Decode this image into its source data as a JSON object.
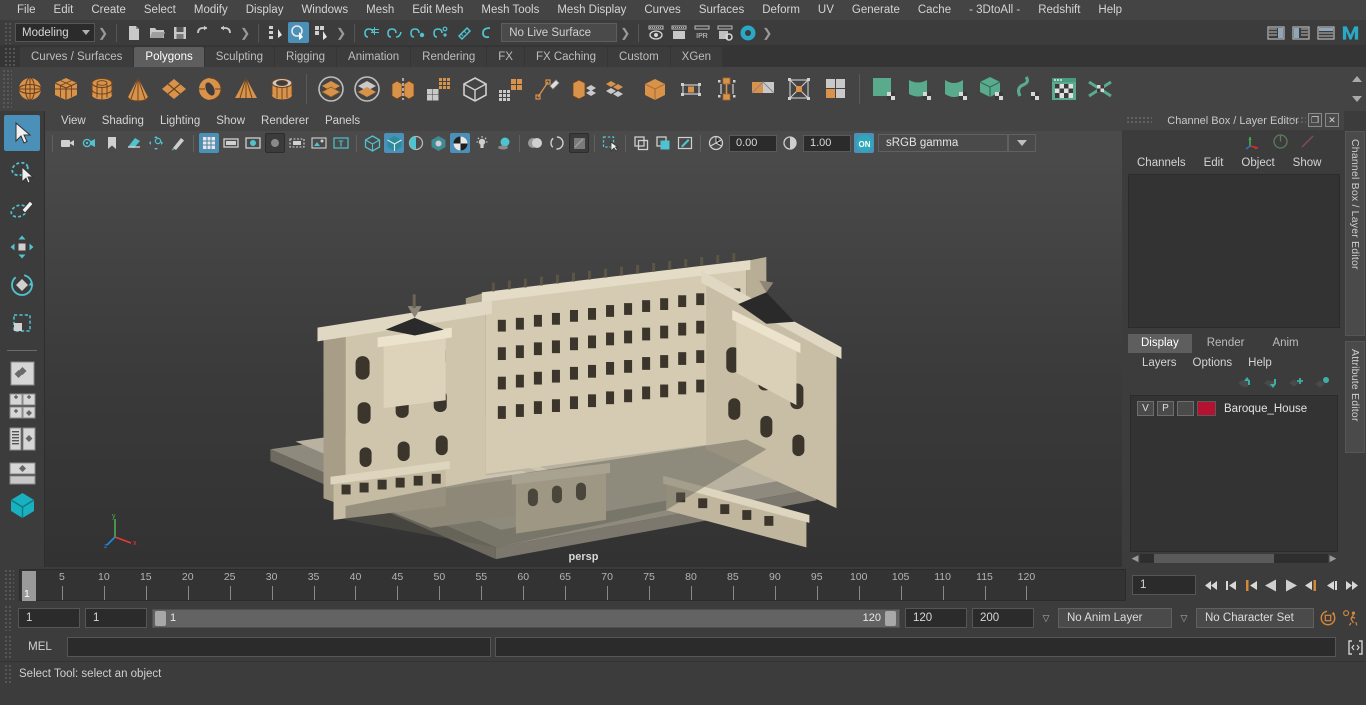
{
  "menubar": {
    "items": [
      "File",
      "Edit",
      "Create",
      "Select",
      "Modify",
      "Display",
      "Windows",
      "Mesh",
      "Edit Mesh",
      "Mesh Tools",
      "Mesh Display",
      "Curves",
      "Surfaces",
      "Deform",
      "UV",
      "Generate",
      "Cache",
      "- 3DtoAll -",
      "Redshift",
      "Help"
    ]
  },
  "statusline": {
    "menuset": "Modeling",
    "live_surface": "No Live Surface",
    "icons": [
      {
        "name": "new-scene-icon"
      },
      {
        "name": "open-scene-icon"
      },
      {
        "name": "save-scene-icon"
      },
      {
        "name": "undo-icon"
      },
      {
        "name": "redo-icon"
      },
      {
        "name": "select-by-hierarchy-icon"
      },
      {
        "name": "select-by-object-icon"
      },
      {
        "name": "select-by-component-icon"
      },
      {
        "name": "snap-to-grid-icon"
      },
      {
        "name": "snap-to-curve-icon"
      },
      {
        "name": "snap-to-point-icon"
      },
      {
        "name": "snap-to-projected-center-icon"
      },
      {
        "name": "snap-to-view-plane-icon"
      },
      {
        "name": "make-live-icon"
      },
      {
        "name": "render-view-icon"
      },
      {
        "name": "render-current-frame-icon"
      },
      {
        "name": "ipr-render-icon"
      },
      {
        "name": "render-settings-icon"
      },
      {
        "name": "hypershade-icon"
      }
    ],
    "right_icons": [
      {
        "name": "show-hide-attribute-editor-icon"
      },
      {
        "name": "show-hide-tool-settings-icon"
      },
      {
        "name": "show-hide-channel-box-icon"
      },
      {
        "name": "maya-logo-icon"
      }
    ]
  },
  "shelf": {
    "tabs": [
      "Curves / Surfaces",
      "Polygons",
      "Sculpting",
      "Rigging",
      "Animation",
      "Rendering",
      "FX",
      "FX Caching",
      "Custom",
      "XGen"
    ],
    "active_tab": "Polygons",
    "icons": [
      {
        "name": "poly-sphere-icon",
        "color": "#d9924a"
      },
      {
        "name": "poly-cube-icon",
        "color": "#d9924a"
      },
      {
        "name": "poly-cylinder-icon",
        "color": "#d9924a"
      },
      {
        "name": "poly-cone-icon",
        "color": "#d9924a"
      },
      {
        "name": "poly-plane-icon",
        "color": "#d9924a"
      },
      {
        "name": "poly-torus-icon",
        "color": "#d9924a"
      },
      {
        "name": "poly-pyramid-icon",
        "color": "#d9924a"
      },
      {
        "name": "poly-pipe-icon",
        "color": "#d9924a"
      },
      {
        "name": "boolean-union-icon",
        "color": "#d9924a"
      },
      {
        "name": "boolean-difference-icon",
        "color": "#d9924a"
      },
      {
        "name": "combine-icon",
        "color": "#d9924a"
      },
      {
        "name": "smooth-icon",
        "color": "#d9924a"
      },
      {
        "name": "mesh-cleanup-icon",
        "color": "#cfcfcf"
      },
      {
        "name": "reduce-icon",
        "color": "#d9924a"
      },
      {
        "name": "multi-cut-icon",
        "color": "#d9924a"
      },
      {
        "name": "extrude-icon",
        "color": "#d9924a"
      },
      {
        "name": "bevel-icon",
        "color": "#d9924a"
      },
      {
        "name": "bridge-icon",
        "color": "#d9924a"
      },
      {
        "name": "merge-icon",
        "color": "#d9924a"
      },
      {
        "name": "append-polygon-icon",
        "color": "#d9924a"
      },
      {
        "name": "fill-hole-icon",
        "color": "#d9924a"
      },
      {
        "name": "target-weld-icon",
        "color": "#d9924a"
      },
      {
        "name": "quadrangulate-icon",
        "color": "#d9924a"
      },
      {
        "name": "uv-planar-icon",
        "color": "#5aab8e"
      },
      {
        "name": "uv-cylindrical-icon",
        "color": "#5aab8e"
      },
      {
        "name": "uv-spherical-icon",
        "color": "#5aab8e"
      },
      {
        "name": "uv-automatic-icon",
        "color": "#5aab8e"
      },
      {
        "name": "uv-unfold-icon",
        "color": "#5aab8e"
      },
      {
        "name": "uv-editor-icon",
        "color": "#5aab8e"
      },
      {
        "name": "uv-cut-sew-icon",
        "color": "#5aab8e"
      }
    ]
  },
  "toolbox": {
    "items": [
      {
        "name": "select-tool",
        "active": true
      },
      {
        "name": "lasso-select-tool",
        "active": false
      },
      {
        "name": "paint-select-tool",
        "active": false
      },
      {
        "name": "move-tool",
        "active": false
      },
      {
        "name": "rotate-tool",
        "active": false
      },
      {
        "name": "scale-tool",
        "active": false
      },
      {
        "name": "last-tool-used",
        "active": false
      },
      {
        "name": "single-perspective-layout",
        "active": false
      },
      {
        "name": "four-view-layout",
        "active": false
      },
      {
        "name": "persp-outliner-layout",
        "active": false
      },
      {
        "name": "persp-graph-layout",
        "active": false
      },
      {
        "name": "hypershade-layout",
        "active": false
      }
    ]
  },
  "viewport": {
    "menu": [
      "View",
      "Shading",
      "Lighting",
      "Show",
      "Renderer",
      "Panels"
    ],
    "camera_label": "persp",
    "exposure": "0.00",
    "gamma": "1.00",
    "color_profile": "sRGB gamma",
    "toolbar_icons": [
      {
        "name": "select-camera-icon"
      },
      {
        "name": "camera-attributes-icon"
      },
      {
        "name": "bookmark-icon"
      },
      {
        "name": "image-plane-icon"
      },
      {
        "name": "two-d-pan-zoom-icon"
      },
      {
        "name": "grease-pencil-icon"
      },
      {
        "name": "grid-display-icon",
        "on": true
      },
      {
        "name": "film-gate-icon"
      },
      {
        "name": "resolution-gate-icon"
      },
      {
        "name": "gate-mask-icon",
        "sunk": true
      },
      {
        "name": "film-origin-icon"
      },
      {
        "name": "safe-action-icon"
      },
      {
        "name": "title-safe-icon"
      },
      {
        "name": "wireframe-shading-icon"
      },
      {
        "name": "smooth-shade-all-icon",
        "on": true
      },
      {
        "name": "shade-with-wireframe-icon"
      },
      {
        "name": "use-all-lights-icon"
      },
      {
        "name": "textured-shading-icon",
        "on": true
      },
      {
        "name": "use-default-light-icon"
      },
      {
        "name": "shadows-icon"
      },
      {
        "name": "screen-space-ao-icon"
      },
      {
        "name": "motion-blur-icon"
      },
      {
        "name": "multisample-aa-icon"
      },
      {
        "name": "depth-of-field-icon",
        "sunk": true
      },
      {
        "name": "isolate-select-icon"
      },
      {
        "name": "xray-icon"
      },
      {
        "name": "xray-joints-icon"
      },
      {
        "name": "xray-active-components-icon"
      }
    ],
    "axis_labels": {
      "x": "x",
      "y": "y",
      "z": "z"
    }
  },
  "channel_box": {
    "title": "Channel Box / Layer Editor",
    "menu": [
      "Channels",
      "Edit",
      "Object",
      "Show"
    ],
    "header_icons": [
      {
        "name": "channel-box-toggle-icon"
      },
      {
        "name": "attribute-editor-toggle-icon"
      },
      {
        "name": "modeling-toolkit-toggle-icon"
      }
    ],
    "window_buttons": [
      {
        "name": "undock-panel-button",
        "glyph": "❐"
      },
      {
        "name": "close-panel-button",
        "glyph": "✕"
      }
    ]
  },
  "layer_editor": {
    "tabs": [
      "Display",
      "Render",
      "Anim"
    ],
    "active_tab": "Display",
    "menu": [
      "Layers",
      "Options",
      "Help"
    ],
    "buttons": [
      {
        "name": "move-layer-up-icon"
      },
      {
        "name": "move-layer-down-icon"
      },
      {
        "name": "new-layer-icon"
      },
      {
        "name": "new-layer-from-selected-icon"
      }
    ],
    "layers": [
      {
        "visibility": "V",
        "playback": "P",
        "type": "",
        "color": "#b41230",
        "name": "Baroque_House"
      }
    ]
  },
  "vertical_tabs": [
    "Channel Box / Layer Editor",
    "Attribute Editor"
  ],
  "timeline": {
    "ticks": [
      5,
      10,
      15,
      20,
      25,
      30,
      35,
      40,
      45,
      50,
      55,
      60,
      65,
      70,
      75,
      80,
      85,
      90,
      95,
      100,
      105,
      110,
      115,
      120
    ],
    "current_frame": "1",
    "frame_field": "1",
    "playback_buttons": [
      {
        "name": "go-to-start-button"
      },
      {
        "name": "step-back-keyframe-button"
      },
      {
        "name": "step-back-frame-button"
      },
      {
        "name": "play-backwards-button"
      },
      {
        "name": "play-forwards-button"
      },
      {
        "name": "step-forward-frame-button"
      },
      {
        "name": "step-forward-keyframe-button"
      },
      {
        "name": "go-to-end-button"
      }
    ]
  },
  "range": {
    "anim_start": "1",
    "range_start": "1",
    "slider_min": "1",
    "slider_max": "120",
    "range_end": "120",
    "anim_end": "200",
    "anim_layer": "No Anim Layer",
    "character_set": "No Character Set",
    "buttons": [
      {
        "name": "auto-keyframe-toggle-icon"
      },
      {
        "name": "animation-preferences-icon"
      }
    ]
  },
  "command_line": {
    "language_label": "MEL",
    "input_value": "",
    "output_value": "",
    "script_editor_button": "script-editor-icon"
  },
  "help_line": {
    "text": "Select Tool: select an object"
  }
}
